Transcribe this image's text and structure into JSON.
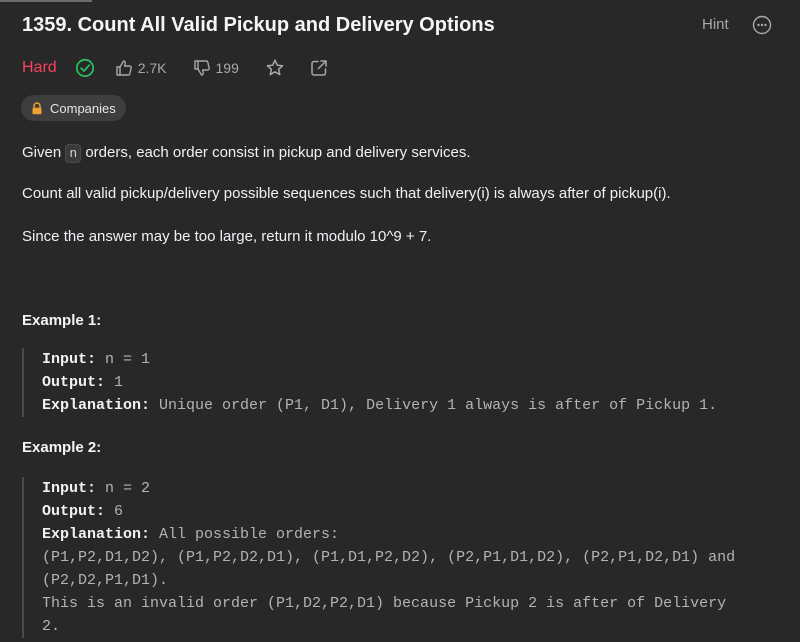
{
  "problem": {
    "title": "1359. Count All Valid Pickup and Delivery Options",
    "difficulty": "Hard",
    "hint_label": "Hint",
    "likes": "2.7K",
    "dislikes": "199",
    "companies_label": "Companies",
    "difficulty_color": "#f8415d",
    "solved_color": "#2cbb5d"
  },
  "description": {
    "p1_before": "Given ",
    "p1_code": "n",
    "p1_after": " orders, each order consist in pickup and delivery services.",
    "p2": "Count all valid pickup/delivery possible sequences such that delivery(i) is always after of pickup(i).",
    "p3": "Since the answer may be too large, return it modulo 10^9 + 7."
  },
  "examples": [
    {
      "title": "Example 1:",
      "input_label": "Input:",
      "input": " n = 1",
      "output_label": "Output:",
      "output": " 1",
      "explanation_label": "Explanation:",
      "explanation_lines": [
        " Unique order (P1, D1), Delivery 1 always is after of Pickup 1."
      ]
    },
    {
      "title": "Example 2:",
      "input_label": "Input:",
      "input": " n = 2",
      "output_label": "Output:",
      "output": " 6",
      "explanation_label": "Explanation:",
      "explanation_lines": [
        " All possible orders: ",
        "(P1,P2,D1,D2), (P1,P2,D2,D1), (P1,D1,P2,D2), (P2,P1,D1,D2), (P2,P1,D2,D1) and",
        "(P2,D2,P1,D1).",
        "This is an invalid order (P1,D2,P2,D1) because Pickup 2 is after of Delivery",
        "2."
      ]
    }
  ],
  "icons": [
    "check-circle-icon",
    "thumbs-up-icon",
    "thumbs-down-icon",
    "star-icon",
    "share-icon",
    "more-icon",
    "lock-icon"
  ]
}
